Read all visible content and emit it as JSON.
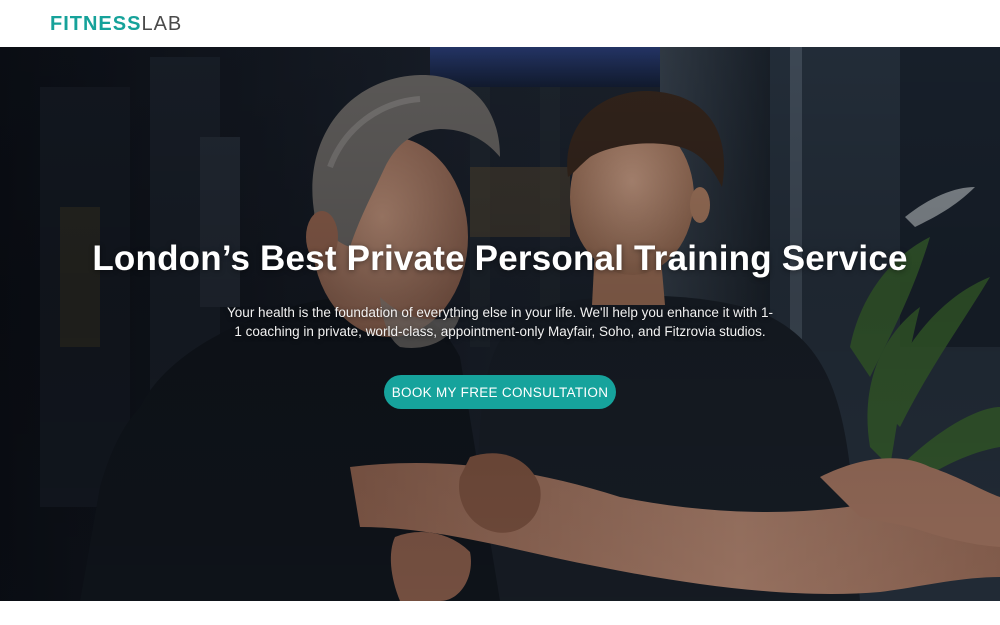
{
  "header": {
    "logo_strong": "FITNESS",
    "logo_light": "LAB"
  },
  "hero": {
    "title": "London’s Best Private Personal Training Service",
    "subtitle": "Your health is the foundation of everything else in your life. We'll help you enhance it with 1-1 coaching in private, world-class, appointment-only Mayfair, Soho, and Fitzrovia studios.",
    "cta_label": "BOOK MY FREE CONSULTATION"
  },
  "colors": {
    "brand": "#16a29a",
    "cta": "#16a39c",
    "logo_dark": "#4a4a4a"
  }
}
